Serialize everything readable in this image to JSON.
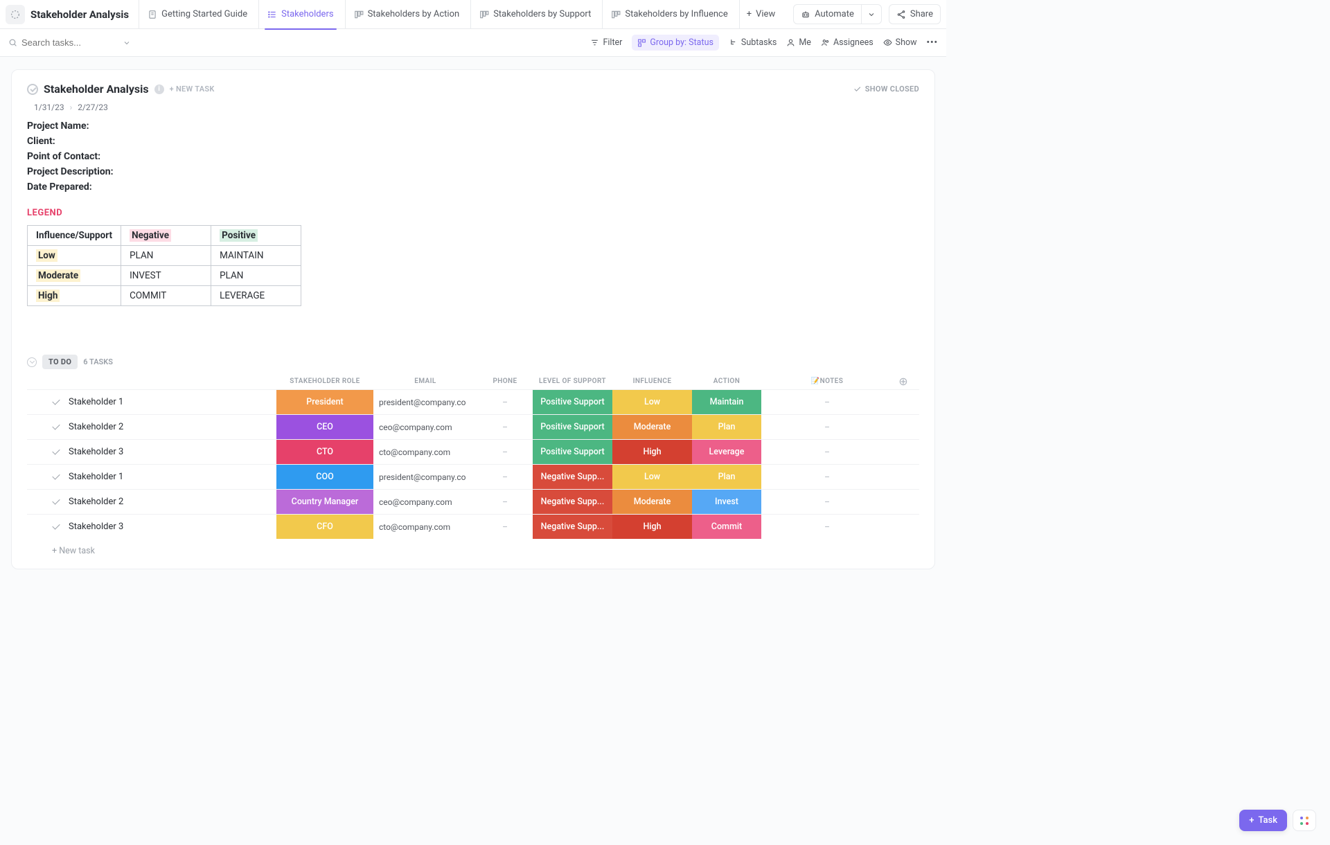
{
  "header": {
    "title": "Stakeholder Analysis",
    "tabs": [
      {
        "label": "Getting Started Guide"
      },
      {
        "label": "Stakeholders"
      },
      {
        "label": "Stakeholders by Action"
      },
      {
        "label": "Stakeholders by Support"
      },
      {
        "label": "Stakeholders by Influence"
      }
    ],
    "add_view": "View",
    "automate": "Automate",
    "share": "Share"
  },
  "toolbar": {
    "search_placeholder": "Search tasks...",
    "filter": "Filter",
    "group_by": "Group by: Status",
    "subtasks": "Subtasks",
    "me": "Me",
    "assignees": "Assignees",
    "show": "Show"
  },
  "card": {
    "title": "Stakeholder Analysis",
    "new_task": "+ NEW TASK",
    "show_closed": "SHOW CLOSED",
    "date_start": "1/31/23",
    "date_end": "2/27/23",
    "fields": [
      "Project Name:",
      "Client:",
      "Point of Contact:",
      "Project Description:",
      "Date Prepared:"
    ],
    "legend_title": "LEGEND",
    "legend": {
      "header": [
        "Influence/Support",
        "Negative",
        "Positive"
      ],
      "rows": [
        [
          "Low",
          "PLAN",
          "MAINTAIN"
        ],
        [
          "Moderate",
          "INVEST",
          "PLAN"
        ],
        [
          "High",
          "COMMIT",
          "LEVERAGE"
        ]
      ]
    }
  },
  "group": {
    "status": "TO DO",
    "count": "6 TASKS",
    "columns": [
      "STAKEHOLDER ROLE",
      "EMAIL",
      "PHONE",
      "LEVEL OF SUPPORT",
      "INFLUENCE",
      "ACTION",
      "📝NOTES"
    ]
  },
  "colors": {
    "orange": "#f2994a",
    "purple": "#9b51e0",
    "magenta": "#e6416a",
    "blue": "#2f9bf0",
    "violet": "#bb6bd9",
    "yellow": "#f2c94c",
    "green": "#4cb782",
    "dorange": "#eb8c3e",
    "red": "#d84b3b",
    "pink": "#ed5f8a",
    "lblue": "#56a8f5",
    "hotpink": "#ed5f8a",
    "dred": "#d44030"
  },
  "rows": [
    {
      "name": "Stakeholder 1",
      "role": "President",
      "role_c": "orange",
      "email": "president@company.co",
      "phone": "–",
      "support": "Positive Support",
      "support_c": "green",
      "influence": "Low",
      "influence_c": "yellow",
      "action": "Maintain",
      "action_c": "green",
      "notes": "–"
    },
    {
      "name": "Stakeholder 2",
      "role": "CEO",
      "role_c": "purple",
      "email": "ceo@company.com",
      "phone": "–",
      "support": "Positive Support",
      "support_c": "green",
      "influence": "Moderate",
      "influence_c": "dorange",
      "action": "Plan",
      "action_c": "yellow",
      "notes": "–"
    },
    {
      "name": "Stakeholder 3",
      "role": "CTO",
      "role_c": "magenta",
      "email": "cto@company.com",
      "phone": "–",
      "support": "Positive Support",
      "support_c": "green",
      "influence": "High",
      "influence_c": "dred",
      "action": "Leverage",
      "action_c": "hotpink",
      "notes": "–"
    },
    {
      "name": "Stakeholder 1",
      "role": "COO",
      "role_c": "blue",
      "email": "president@company.co",
      "phone": "–",
      "support": "Negative Supp...",
      "support_c": "red",
      "influence": "Low",
      "influence_c": "yellow",
      "action": "Plan",
      "action_c": "yellow",
      "notes": "–"
    },
    {
      "name": "Stakeholder 2",
      "role": "Country Manager",
      "role_c": "violet",
      "email": "ceo@company.com",
      "phone": "–",
      "support": "Negative Supp...",
      "support_c": "red",
      "influence": "Moderate",
      "influence_c": "dorange",
      "action": "Invest",
      "action_c": "lblue",
      "notes": "–"
    },
    {
      "name": "Stakeholder 3",
      "role": "CFO",
      "role_c": "yellow",
      "email": "cto@company.com",
      "phone": "–",
      "support": "Negative Supp...",
      "support_c": "red",
      "influence": "High",
      "influence_c": "dred",
      "action": "Commit",
      "action_c": "hotpink",
      "notes": "–"
    }
  ],
  "new_task_row": "+ New task",
  "fab": "Task"
}
